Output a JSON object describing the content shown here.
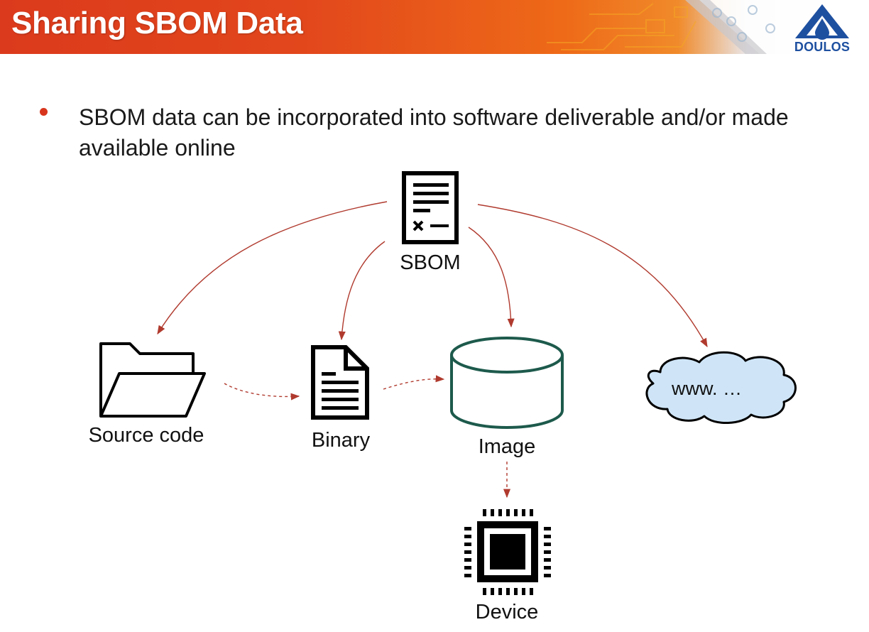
{
  "slide": {
    "title": "Sharing SBOM Data",
    "logo_text": "DOULOS",
    "bullet": "SBOM data can be incorporated into software deliverable and/or made available online"
  },
  "diagram": {
    "nodes": {
      "sbom": "SBOM",
      "source_code": "Source code",
      "binary": "Binary",
      "image": "Image",
      "device": "Device",
      "online": "www. …"
    }
  },
  "colors": {
    "header_red": "#dc3a1c",
    "bullet": "#d8351d",
    "arrow": "#b03a2e",
    "cylinder_stroke": "#1d5a4c",
    "cloud_fill": "#cfe5f7",
    "logo_blue": "#1e50a0"
  },
  "icons": {
    "sbom": "document-checklist-icon",
    "source_code": "folder-open-icon",
    "binary": "document-icon",
    "image": "database-cylinder-icon",
    "device": "chip-icon",
    "online": "cloud-icon"
  }
}
